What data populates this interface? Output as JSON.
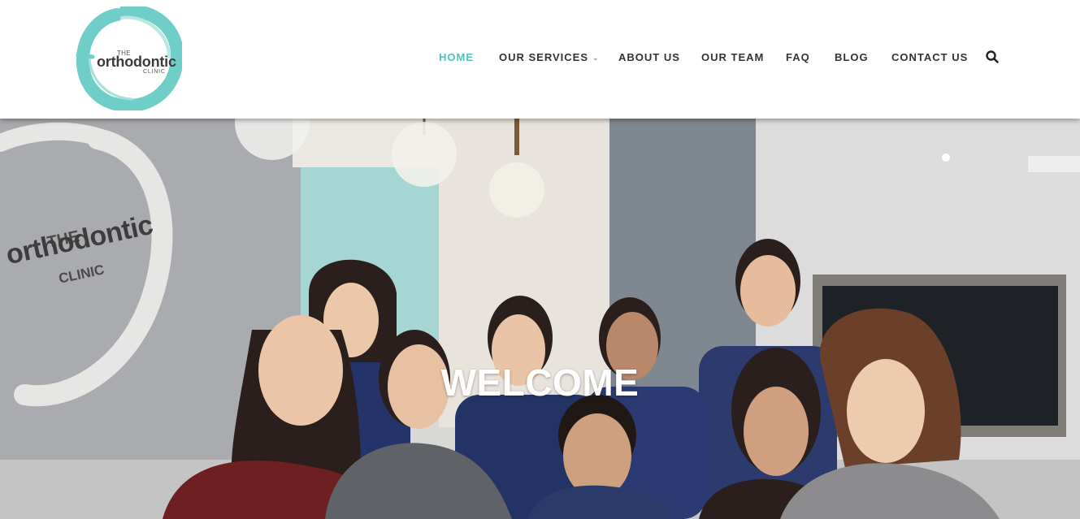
{
  "brand": {
    "logo_the": "THE",
    "logo_word": "orthodontic",
    "logo_clinic": "CLINIC",
    "accent_color": "#4fc0c0"
  },
  "nav": {
    "items": [
      {
        "label": "HOME",
        "active": true
      },
      {
        "label": "OUR SERVICES",
        "has_dropdown": true
      },
      {
        "label": "ABOUT US"
      },
      {
        "label": "OUR TEAM"
      },
      {
        "label": "FAQ"
      },
      {
        "label": "BLOG"
      },
      {
        "label": "CONTACT US"
      }
    ],
    "search_icon": "search-icon",
    "dropdown_icon": "chevron-down-icon"
  },
  "hero": {
    "heading": "WELCOME",
    "wall_the": "THE",
    "wall_word": "orthodontic",
    "wall_clinic": "CLINIC"
  }
}
